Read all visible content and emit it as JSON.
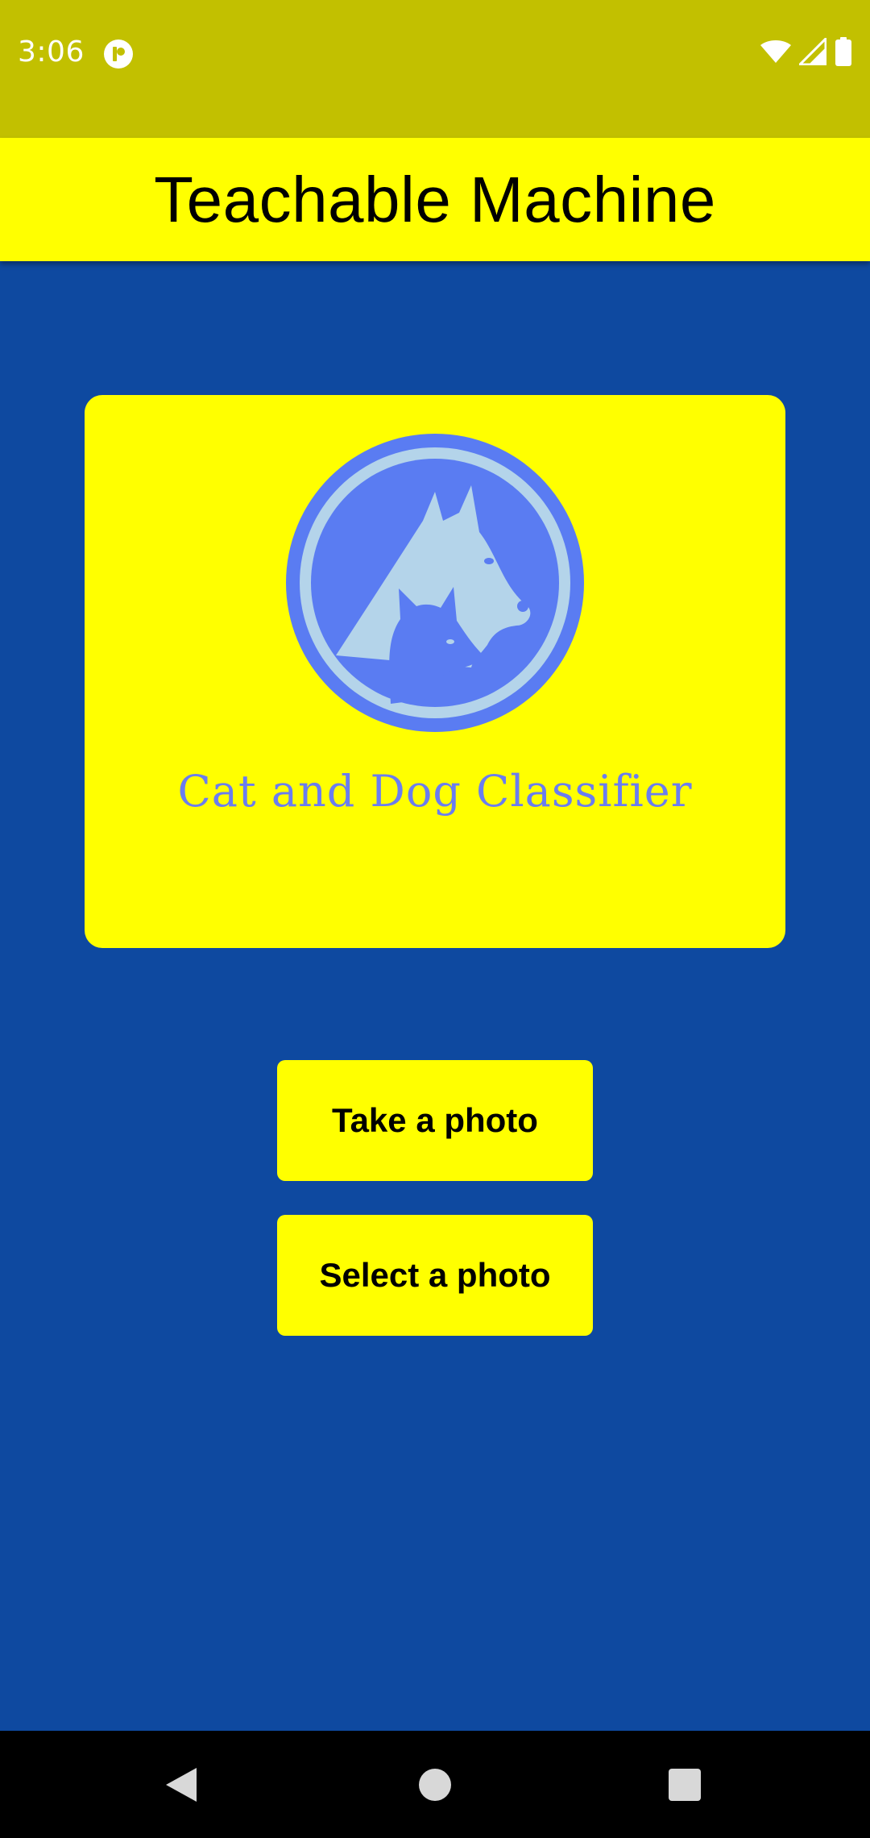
{
  "status_bar": {
    "time": "3:06",
    "background": "#c2c000",
    "icons": [
      "app-notification-icon",
      "wifi-icon",
      "cellular-signal-icon",
      "battery-icon"
    ]
  },
  "app_bar": {
    "title": "Teachable Machine",
    "background": "#ffff00"
  },
  "main": {
    "background": "#0e49a0",
    "logo": {
      "caption": "Cat and Dog Classifier",
      "icon": "cat-dog-logo-icon",
      "card_color": "#ffff00",
      "emblem_color": "#5a7cf2",
      "emblem_light_color": "#b4d4ea"
    },
    "buttons": {
      "take_photo_label": "Take a photo",
      "select_photo_label": "Select a photo",
      "color": "#ffff00"
    }
  },
  "nav_bar": {
    "icons": [
      "back-icon",
      "home-icon",
      "recents-icon"
    ]
  }
}
